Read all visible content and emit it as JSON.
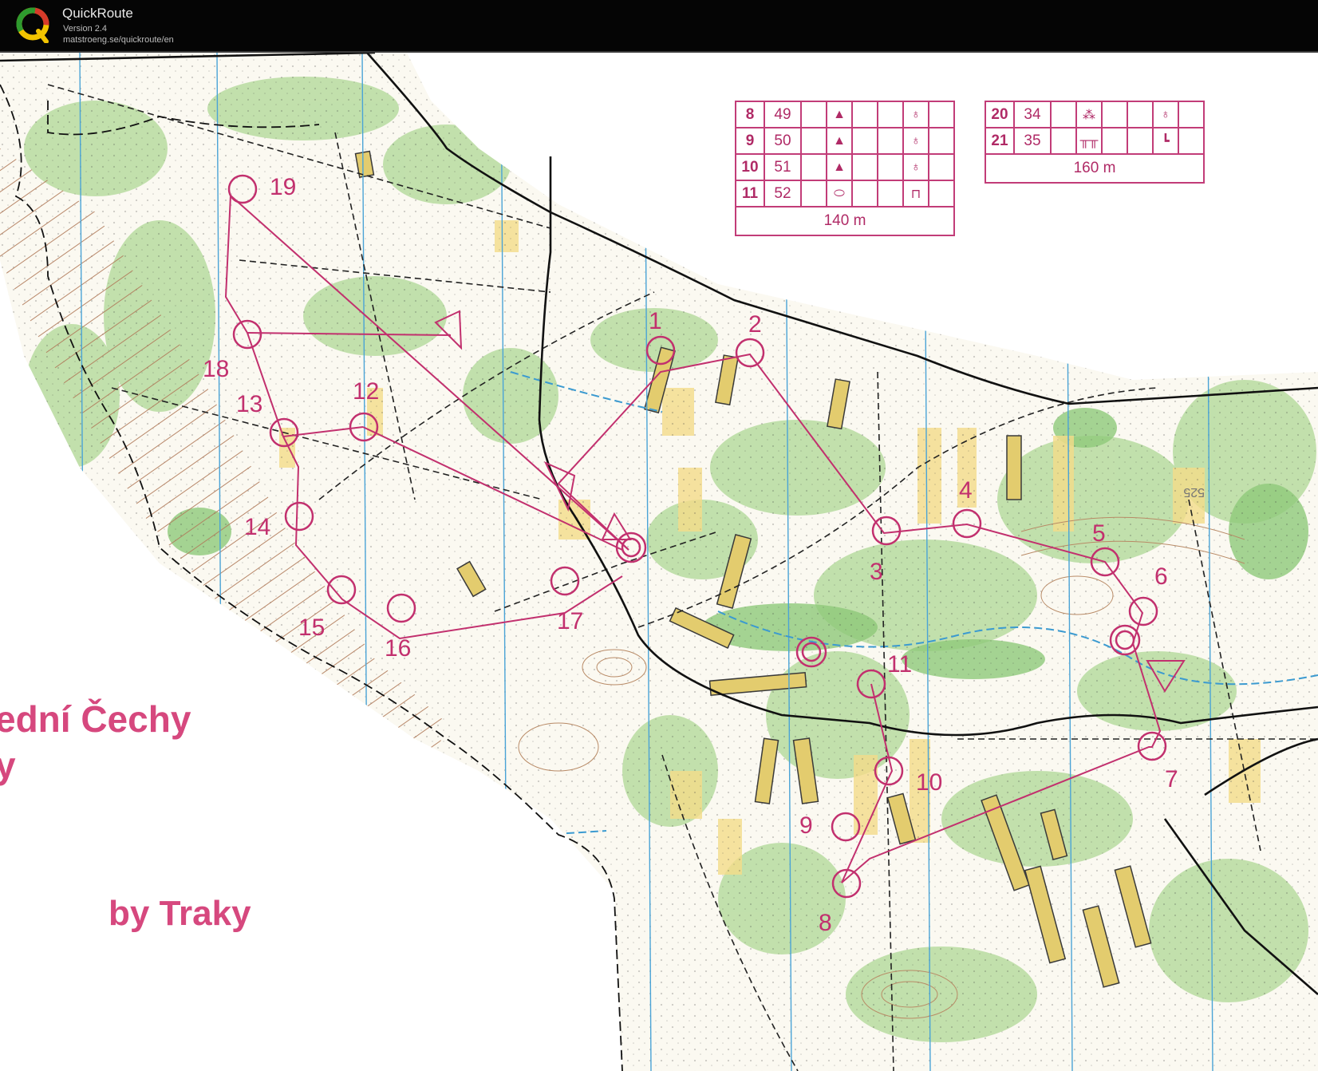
{
  "app": {
    "name": "QuickRoute",
    "version": "Version 2.4",
    "url": "matstroeng.se/quickroute/en"
  },
  "map": {
    "title": "ední Čechy\ny",
    "author": "by Traky",
    "course_color": "#c2306e",
    "controls": [
      {
        "label": "1"
      },
      {
        "label": "2"
      },
      {
        "label": "3"
      },
      {
        "label": "4"
      },
      {
        "label": "5"
      },
      {
        "label": "6"
      },
      {
        "label": "7"
      },
      {
        "label": "8"
      },
      {
        "label": "9"
      },
      {
        "label": "10"
      },
      {
        "label": "11"
      },
      {
        "label": "12"
      },
      {
        "label": "13"
      },
      {
        "label": "14"
      },
      {
        "label": "15"
      },
      {
        "label": "16"
      },
      {
        "label": "17"
      },
      {
        "label": "18"
      },
      {
        "label": "19"
      }
    ],
    "contour_label": "525"
  },
  "description_tables": [
    {
      "rows": [
        {
          "num": "8",
          "code": "49",
          "feature": "▲",
          "detail": "♁"
        },
        {
          "num": "9",
          "code": "50",
          "feature": "▲",
          "detail": "♁"
        },
        {
          "num": "10",
          "code": "51",
          "feature": "▲",
          "detail": "♁"
        },
        {
          "num": "11",
          "code": "52",
          "feature": "⬭",
          "detail": "⊓"
        }
      ],
      "footer": "140 m"
    },
    {
      "rows": [
        {
          "num": "20",
          "code": "34",
          "feature": "⁂",
          "detail": "♁"
        },
        {
          "num": "21",
          "code": "35",
          "feature": "╥╥",
          "detail": "┗"
        }
      ],
      "footer": "160 m"
    }
  ]
}
